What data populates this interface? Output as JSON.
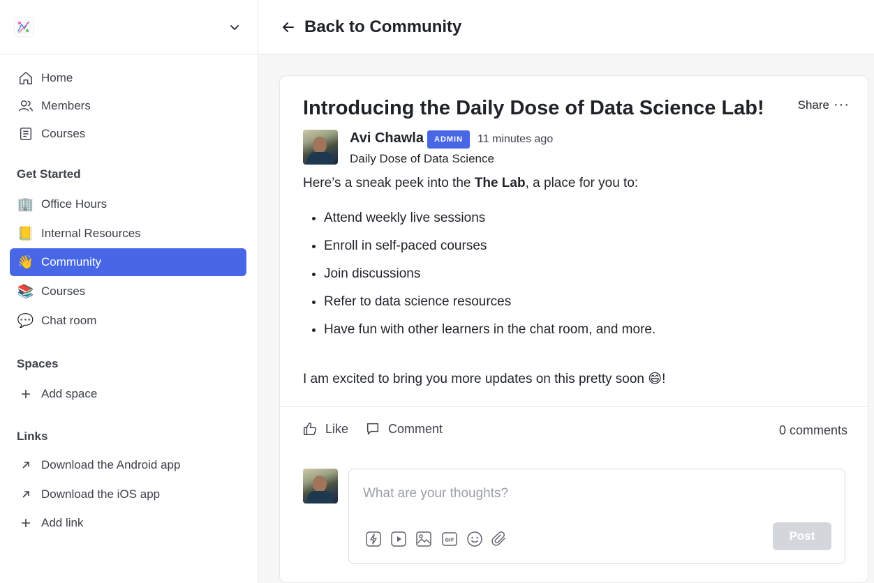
{
  "sidebar": {
    "logo_icon": "community-logo-icon",
    "main_nav": [
      {
        "label": "Home",
        "icon": "home-icon"
      },
      {
        "label": "Members",
        "icon": "members-icon"
      },
      {
        "label": "Courses",
        "icon": "courses-icon"
      }
    ],
    "get_started": {
      "title": "Get Started",
      "items": [
        {
          "label": "Office Hours",
          "emoji": "🏢"
        },
        {
          "label": "Internal Resources",
          "emoji": "📒"
        },
        {
          "label": "Community",
          "emoji": "👋",
          "active": true
        },
        {
          "label": "Courses",
          "emoji": "📚"
        },
        {
          "label": "Chat room",
          "emoji": "💬"
        }
      ]
    },
    "spaces": {
      "title": "Spaces",
      "add_label": "Add space"
    },
    "links": {
      "title": "Links",
      "items": [
        {
          "label": "Download the Android app"
        },
        {
          "label": "Download the iOS app"
        }
      ],
      "add_label": "Add link"
    }
  },
  "header": {
    "back_label": "Back to Community"
  },
  "post": {
    "title": "Introducing the Daily Dose of Data Science Lab!",
    "share_label": "Share",
    "more_label": "···",
    "author": "Avi Chawla",
    "badge": "ADMIN",
    "time": "11 minutes ago",
    "space": "Daily Dose of Data Science",
    "intro_before": "Here’s a sneak peek into the ",
    "intro_bold": "The Lab",
    "intro_after": ", a place for you to:",
    "bullets": [
      "Attend weekly live sessions",
      "Enroll in self-paced courses",
      "Join discussions",
      "Refer to data science resources",
      "Have fun with other learners in the chat room, and more."
    ],
    "closing": "I am excited to bring you more updates on this pretty soon 😄!",
    "like_label": "Like",
    "comment_label": "Comment",
    "comments_count": "0 comments"
  },
  "composer": {
    "placeholder": "What are your thoughts?",
    "post_label": "Post",
    "tools": [
      "lightning-icon",
      "video-icon",
      "image-icon",
      "gif-icon",
      "emoji-icon",
      "attachment-icon"
    ],
    "gif_text": "GIF"
  },
  "colors": {
    "accent": "#4867e6",
    "post_button_disabled": "#d3d6db"
  }
}
